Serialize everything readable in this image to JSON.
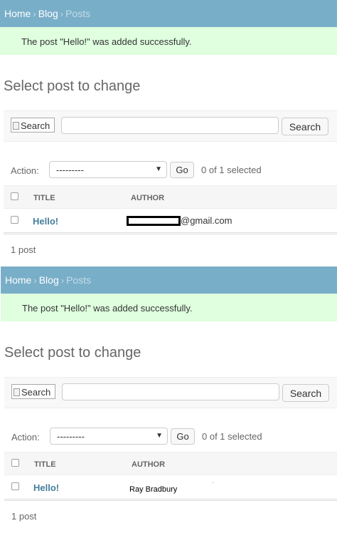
{
  "panels": [
    {
      "breadcrumb": {
        "home": "Home",
        "sep1": "›",
        "blog": "Blog",
        "sep2": "›",
        "current": "Posts"
      },
      "message": "The post \"Hello!\" was added successfully.",
      "title": "Select post to change",
      "search": {
        "image_alt": "Search",
        "value": "",
        "button": "Search"
      },
      "actions": {
        "label": "Action:",
        "selected": "---------",
        "go": "Go",
        "count": "0 of 1 selected"
      },
      "table": {
        "columns": [
          "TITLE",
          "AUTHOR"
        ],
        "rows": [
          {
            "title": "Hello!",
            "author": "@gmail.com"
          }
        ]
      },
      "paginator": "1 post"
    },
    {
      "breadcrumb": {
        "home": "Home",
        "sep1": "›",
        "blog": "Blog",
        "sep2": "›",
        "current": "Posts"
      },
      "message": "The post \"Hello!\" was added successfully.",
      "title": "Select post to change",
      "search": {
        "image_alt": "Search",
        "value": "",
        "button": "Search"
      },
      "actions": {
        "label": "Action:",
        "selected": "---------",
        "go": "Go",
        "count": "0 of 1 selected"
      },
      "table": {
        "columns": [
          "TITLE",
          "AUTHOR"
        ],
        "rows": [
          {
            "title": "Hello!",
            "author": "Ray Bradbury"
          }
        ]
      },
      "paginator": "1 post"
    }
  ],
  "colors": {
    "header_bg": "#79aec8",
    "message_bg": "#dfffdf",
    "link": "#447e9b",
    "redaction": "#000000"
  },
  "icons": [
    "broken-image-icon",
    "dropdown-caret-icon",
    "checkbox-icon"
  ]
}
